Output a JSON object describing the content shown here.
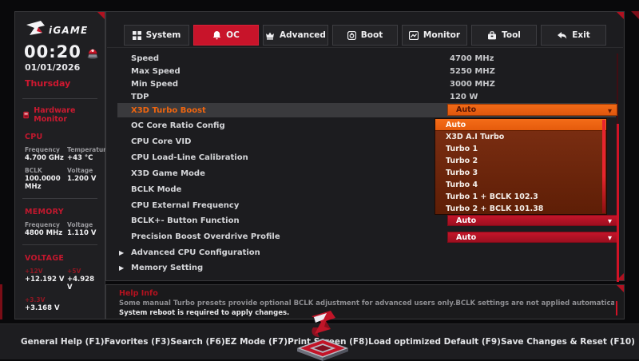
{
  "colors": {
    "accent_red": "#c8142a",
    "accent_orange": "#ee5f13",
    "panel_bg": "#1c1c1f"
  },
  "sidebar": {
    "logo_text": "iGAME",
    "clock": {
      "time": "00:20",
      "date": "01/01/2026",
      "weekday": "Thursday"
    },
    "hw_monitor_title": "Hardware Monitor",
    "cpu": {
      "title": "CPU",
      "rows": [
        {
          "label": "Frequency",
          "value": "4.700 GHz"
        },
        {
          "label": "Temperature",
          "value": "+43 °C"
        },
        {
          "label": "BCLK",
          "value": "100.0000 MHz"
        },
        {
          "label": "Voltage",
          "value": "1.200 V"
        }
      ]
    },
    "memory": {
      "title": "MEMORY",
      "rows": [
        {
          "label": "Frequency",
          "value": "4800 MHz"
        },
        {
          "label": "Voltage",
          "value": "1.110 V"
        }
      ]
    },
    "voltage": {
      "title": "VOLTAGE",
      "rows": [
        {
          "label": "+12V",
          "value": "+12.192 V"
        },
        {
          "label": "+5V",
          "value": "+4.928 V"
        },
        {
          "label": "+3.3V",
          "value": "+3.168 V"
        }
      ]
    }
  },
  "tabs": [
    {
      "label": "System"
    },
    {
      "label": "OC",
      "active": true
    },
    {
      "label": "Advanced"
    },
    {
      "label": "Boot"
    },
    {
      "label": "Monitor"
    },
    {
      "label": "Tool"
    },
    {
      "label": "Exit"
    }
  ],
  "settings": {
    "info_rows": [
      {
        "label": "Speed",
        "value": "4700 MHz"
      },
      {
        "label": "Max Speed",
        "value": "5250 MHZ"
      },
      {
        "label": "Min Speed",
        "value": "3000 MHZ"
      },
      {
        "label": "TDP",
        "value": "120 W"
      }
    ],
    "selected_row": {
      "label": "X3D Turbo Boost",
      "value": "Auto"
    },
    "plain_rows": [
      "OC Core Ratio Config",
      "CPU Core VID",
      "CPU Load-Line Calibration",
      "X3D Game Mode",
      "BCLK Mode",
      "CPU External Frequency"
    ],
    "dropdown_rows": [
      {
        "label": "BCLK+- Button Function",
        "value": "Auto"
      },
      {
        "label": "Precision Boost Overdrive Profile",
        "value": "Auto"
      }
    ],
    "submenu_rows": [
      "Advanced CPU Configuration",
      "Memory Setting"
    ],
    "dropdown_options": [
      "Auto",
      "X3D A.I Turbo",
      "Turbo 1",
      "Turbo 2",
      "Turbo 3",
      "Turbo 4",
      "Turbo 1 + BCLK 102.3",
      "Turbo 2 + BCLK 101.38"
    ],
    "dropdown_selected": "Auto"
  },
  "help": {
    "title": "Help Info",
    "line1": "Some manual Turbo presets provide optional BCLK adjustment for advanced users only.BCLK settings are not applied automatically.",
    "line2": "System reboot is required to apply changes."
  },
  "footer": {
    "items": [
      "General Help (F1)",
      "Favorites (F3)",
      "Search (F6)",
      "EZ Mode (F7)",
      "Print Screen (F8)",
      "Load optimized Default (F9)",
      "Save Changes & Reset (F10)"
    ]
  }
}
